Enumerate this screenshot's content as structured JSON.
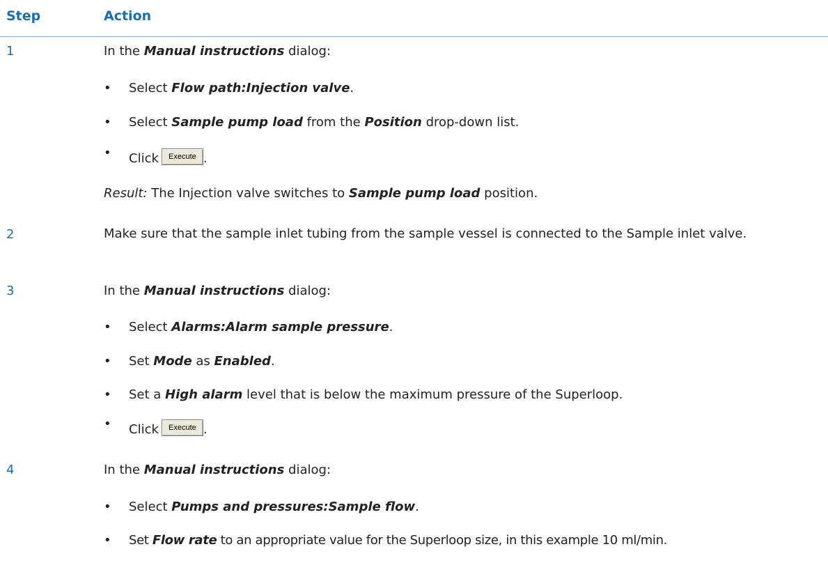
{
  "header": {
    "step_label": "Step",
    "action_label": "Action"
  },
  "steps": [
    {
      "number": "1",
      "intro_prefix": "In the ",
      "intro_bold": "Manual instructions",
      "intro_suffix": " dialog:",
      "b1_prefix": "Select ",
      "b1_bold": "Flow path:Injection valve",
      "b1_suffix": ".",
      "b2_prefix": "Select ",
      "b2_bold1": "Sample pump load",
      "b2_mid": " from the ",
      "b2_bold2": "Position",
      "b2_suffix": " drop-down list.",
      "b3_prefix": "Click",
      "b3_button": "Execute",
      "b3_suffix": ".",
      "result_label": "Result:",
      "result_text": " The Injection valve switches to ",
      "result_bold": "Sample pump load",
      "result_suffix": " position."
    },
    {
      "number": "2",
      "text": "Make sure that the sample inlet tubing from the sample vessel is connected to the Sample inlet valve."
    },
    {
      "number": "3",
      "intro_prefix": "In the ",
      "intro_bold": "Manual instructions",
      "intro_suffix": " dialog:",
      "b1_prefix": "Select ",
      "b1_bold": "Alarms:Alarm sample pressure",
      "b1_suffix": ".",
      "b2_prefix": "Set ",
      "b2_bold1": "Mode",
      "b2_mid": " as ",
      "b2_bold2": "Enabled",
      "b2_suffix": ".",
      "b3_prefix": "Set a ",
      "b3_bold": "High alarm",
      "b3_suffix": " level that is below the maximum pressure of the Superloop.",
      "b4_prefix": "Click",
      "b4_button": "Execute",
      "b4_suffix": "."
    },
    {
      "number": "4",
      "intro_prefix": "In the ",
      "intro_bold": "Manual instructions",
      "intro_suffix": " dialog:",
      "b1_prefix": "Select ",
      "b1_bold": "Pumps and pressures:Sample flow",
      "b1_suffix": ".",
      "b2_prefix": "Set ",
      "b2_bold": "Flow rate",
      "b2_suffix": " to an appropriate value for the Superloop size, in this example 10 ml/min."
    }
  ],
  "bullet_char": "•"
}
